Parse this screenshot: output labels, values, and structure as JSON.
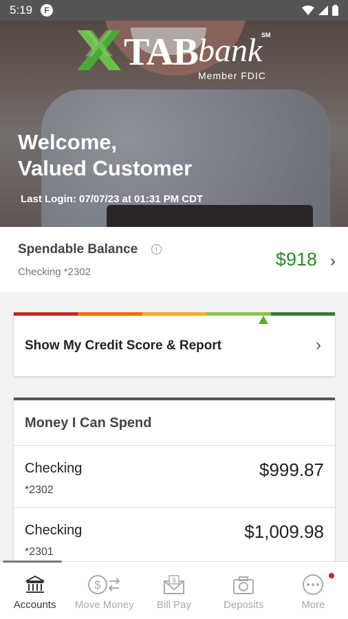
{
  "status_bar": {
    "time": "5:19",
    "notification_badge": "F"
  },
  "hero": {
    "brand_tab": "TAB",
    "brand_bank": "bank",
    "brand_sm": "SM",
    "brand_fdic": "Member FDIC",
    "welcome_line1": "Welcome,",
    "welcome_line2": "Valued Customer",
    "last_login": "Last Login: 07/07/23 at 01:31 PM CDT"
  },
  "balance": {
    "title": "Spendable Balance",
    "info_icon": "i",
    "account": "Checking *2302",
    "amount": "$918",
    "chevron": "›"
  },
  "credit": {
    "label": "Show My Credit Score & Report",
    "chevron": "›",
    "bar_colors": [
      "#c62828",
      "#ef6c00",
      "#f9a825",
      "#8bc34a",
      "#2e7d32"
    ]
  },
  "money": {
    "header": "Money I Can Spend",
    "accounts": [
      {
        "name": "Checking",
        "number": "*2302",
        "amount": "$999.87"
      },
      {
        "name": "Checking",
        "number": "*2301",
        "amount": "$1,009.98"
      }
    ]
  },
  "nav": {
    "items": [
      {
        "label": "Accounts",
        "icon": "bank-icon"
      },
      {
        "label": "Move Money",
        "icon": "transfer-icon"
      },
      {
        "label": "Bill Pay",
        "icon": "envelope-dollar-icon"
      },
      {
        "label": "Deposits",
        "icon": "camera-icon"
      },
      {
        "label": "More",
        "icon": "more-dots-icon"
      }
    ]
  }
}
